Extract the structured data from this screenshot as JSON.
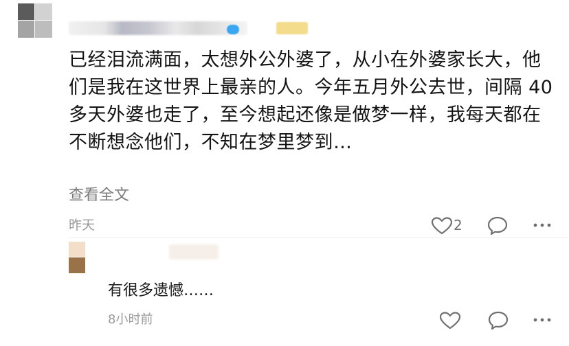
{
  "comment": {
    "text": "已经泪流满面，太想外公外婆了，从小在外婆家长大，他们是我在这世界上最亲的人。今年五月外公去世，间隔 40 多天外婆也走了，至今想起还像是做梦一样，我每天都在不断想念他们，不知在梦里梦到…",
    "expand_label": "查看全文",
    "time": "昨天",
    "like_count": "2"
  },
  "reply": {
    "text": "有很多遗憾……",
    "time": "8小时前"
  },
  "icons": {
    "like": "heart-outline-icon",
    "comment": "speech-bubble-icon",
    "more": "ellipsis-icon"
  },
  "colors": {
    "primary_text": "#141414",
    "secondary_text": "#7b7b7b",
    "meta_text": "#9a9a9a",
    "icon": "#6f6f6f"
  }
}
